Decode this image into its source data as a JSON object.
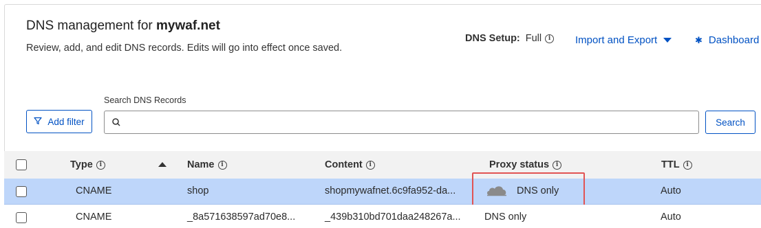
{
  "header": {
    "title_prefix": "DNS management for ",
    "domain": "mywaf.net",
    "description": "Review, add, and edit DNS records. Edits will go into effect once saved."
  },
  "setup": {
    "label": "DNS Setup:",
    "value": "Full"
  },
  "actions": {
    "import_export": "Import and Export",
    "dashboard": "Dashboard"
  },
  "search": {
    "label": "Search DNS Records",
    "value": "",
    "placeholder": "",
    "button": "Search"
  },
  "filter": {
    "label": "Add filter"
  },
  "table": {
    "columns": [
      "Type",
      "Name",
      "Content",
      "Proxy status",
      "TTL"
    ],
    "rows": [
      {
        "type": "CNAME",
        "name": "shop",
        "content": "shopmywafnet.6c9fa952-da...",
        "proxy": "DNS only",
        "ttl": "Auto",
        "selected": true
      },
      {
        "type": "CNAME",
        "name": "_8a571638597ad70e8...",
        "content": "_439b310bd701daa248267a...",
        "proxy": "DNS only",
        "ttl": "Auto",
        "selected": false
      }
    ]
  },
  "colors": {
    "accent": "#0051c3",
    "selected_row": "#bed6fa",
    "highlight": "#e15353"
  },
  "icons": [
    "info-icon",
    "caret-down-icon",
    "gear-icon",
    "filter-icon",
    "search-icon",
    "sort-up-icon",
    "cloud-icon"
  ]
}
